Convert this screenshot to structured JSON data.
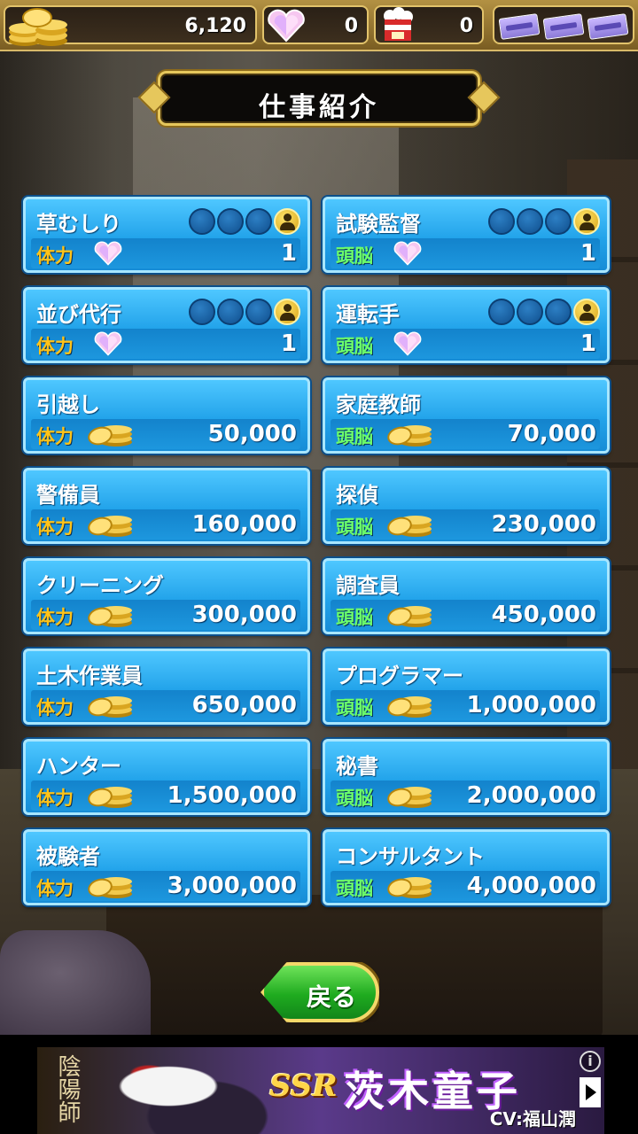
{
  "resources": {
    "coins": "6,120",
    "gems": "0",
    "tickets": "0",
    "passes_icon": "ticket-pass-icon"
  },
  "title": "仕事紹介",
  "jobs": [
    {
      "name": "草むしり",
      "attr": "体力",
      "attr_type": "body",
      "cost_icon": "heart-gem-icon",
      "cost": "1",
      "slots": true
    },
    {
      "name": "試験監督",
      "attr": "頭脳",
      "attr_type": "brain",
      "cost_icon": "heart-gem-icon",
      "cost": "1",
      "slots": true
    },
    {
      "name": "並び代行",
      "attr": "体力",
      "attr_type": "body",
      "cost_icon": "heart-gem-icon",
      "cost": "1",
      "slots": true
    },
    {
      "name": "運転手",
      "attr": "頭脳",
      "attr_type": "brain",
      "cost_icon": "heart-gem-icon",
      "cost": "1",
      "slots": true
    },
    {
      "name": "引越し",
      "attr": "体力",
      "attr_type": "body",
      "cost_icon": "coin-icon",
      "cost": "50,000",
      "slots": false
    },
    {
      "name": "家庭教師",
      "attr": "頭脳",
      "attr_type": "brain",
      "cost_icon": "coin-icon",
      "cost": "70,000",
      "slots": false
    },
    {
      "name": "警備員",
      "attr": "体力",
      "attr_type": "body",
      "cost_icon": "coin-icon",
      "cost": "160,000",
      "slots": false
    },
    {
      "name": "探偵",
      "attr": "頭脳",
      "attr_type": "brain",
      "cost_icon": "coin-icon",
      "cost": "230,000",
      "slots": false
    },
    {
      "name": "クリーニング",
      "attr": "体力",
      "attr_type": "body",
      "cost_icon": "coin-icon",
      "cost": "300,000",
      "slots": false
    },
    {
      "name": "調査員",
      "attr": "頭脳",
      "attr_type": "brain",
      "cost_icon": "coin-icon",
      "cost": "450,000",
      "slots": false
    },
    {
      "name": "土木作業員",
      "attr": "体力",
      "attr_type": "body",
      "cost_icon": "coin-icon",
      "cost": "650,000",
      "slots": false
    },
    {
      "name": "プログラマー",
      "attr": "頭脳",
      "attr_type": "brain",
      "cost_icon": "coin-icon",
      "cost": "1,000,000",
      "slots": false
    },
    {
      "name": "ハンター",
      "attr": "体力",
      "attr_type": "body",
      "cost_icon": "coin-icon",
      "cost": "1,500,000",
      "slots": false
    },
    {
      "name": "秘書",
      "attr": "頭脳",
      "attr_type": "brain",
      "cost_icon": "coin-icon",
      "cost": "2,000,000",
      "slots": false
    },
    {
      "name": "被験者",
      "attr": "体力",
      "attr_type": "body",
      "cost_icon": "coin-icon",
      "cost": "3,000,000",
      "slots": false
    },
    {
      "name": "コンサルタント",
      "attr": "頭脳",
      "attr_type": "brain",
      "cost_icon": "coin-icon",
      "cost": "4,000,000",
      "slots": false
    }
  ],
  "back_button": {
    "label": "戻る"
  },
  "ad": {
    "logo": "陰陽師",
    "rarity": "SSR",
    "character_name": "茨木童子",
    "cv": "CV:福山潤",
    "info_icon": "info-icon",
    "play_icon": "play-icon"
  },
  "colors": {
    "body_attr": "#ffc318",
    "brain_attr": "#6dff6a",
    "card_blue": "#22a3ea",
    "frame_gold": "#e6c75c",
    "button_green": "#1fab1f"
  }
}
